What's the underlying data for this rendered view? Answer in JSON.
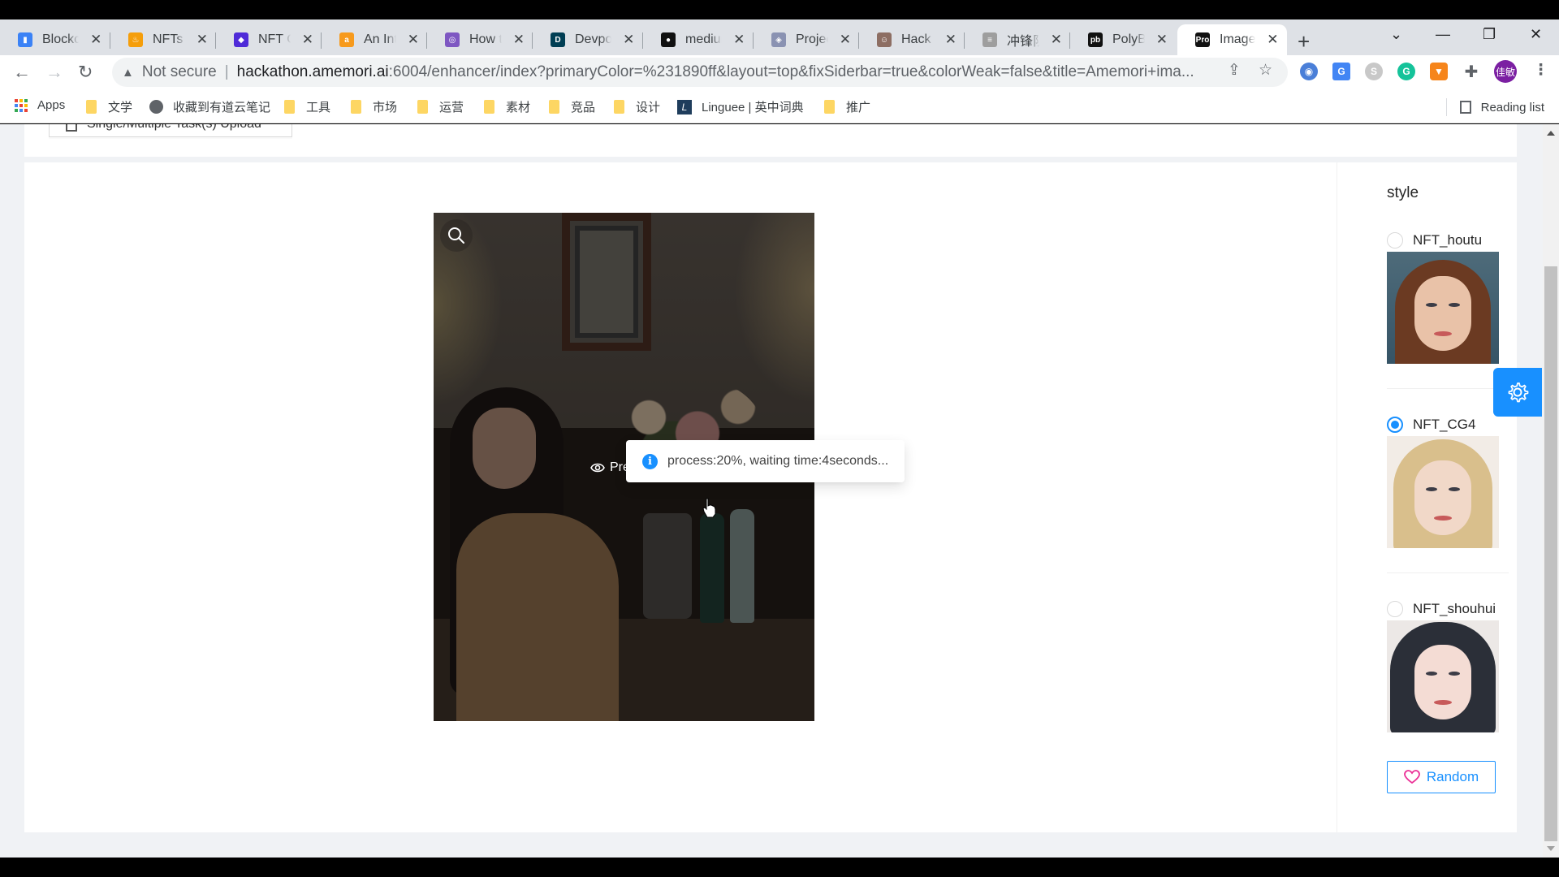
{
  "browser": {
    "tabs": [
      {
        "title": "Blockchain",
        "favicon": "blockchain-icon",
        "color": "#3b82f6",
        "active": false
      },
      {
        "title": "NFTs are",
        "favicon": "flame-icon",
        "color": "#f59e0b",
        "active": false
      },
      {
        "title": "NFT Calendar",
        "favicon": "nft-calendar-icon",
        "color": "#4f2bd8",
        "active": false
      },
      {
        "title": "An Introduction",
        "favicon": "a16z-icon",
        "color": "#f79a1c",
        "active": false
      },
      {
        "title": "How to",
        "favicon": "mirror-icon",
        "color": "#7e57c2",
        "active": false
      },
      {
        "title": "Devpost",
        "favicon": "devpost-icon",
        "color": "#003e54",
        "active": false
      },
      {
        "title": "medium",
        "favicon": "medium-icon",
        "color": "#111111",
        "active": false
      },
      {
        "title": "Project",
        "favicon": "ethereum-icon",
        "color": "#8a92b2",
        "active": false
      },
      {
        "title": "Hack Stack",
        "favicon": "avatar-icon",
        "color": "#8d6e63",
        "active": false
      },
      {
        "title": "冲锋队F",
        "favicon": "sheet-icon",
        "color": "#9e9e9e",
        "active": false
      },
      {
        "title": "PolyBlock",
        "favicon": "pb-icon",
        "color": "#111111",
        "active": false
      },
      {
        "title": "Image",
        "favicon": "pro-icon",
        "color": "#111111",
        "active": true
      }
    ],
    "new_tab_label": "+",
    "address": {
      "security_label": "Not secure",
      "host": "hackathon.amemori.ai",
      "path": ":6004/enhancer/index?primaryColor=%231890ff&layout=top&fixSiderbar=true&colorWeak=false&title=Amemori+ima..."
    },
    "profile_label": "佳敏",
    "bookmarks": [
      {
        "label": "Apps",
        "icon": "apps-grid-icon"
      },
      {
        "label": "文学",
        "icon": "folder-icon"
      },
      {
        "label": "收藏到有道云笔记",
        "icon": "globe-icon"
      },
      {
        "label": "工具",
        "icon": "folder-icon"
      },
      {
        "label": "市场",
        "icon": "folder-icon"
      },
      {
        "label": "运营",
        "icon": "folder-icon"
      },
      {
        "label": "素材",
        "icon": "folder-icon"
      },
      {
        "label": "竞品",
        "icon": "folder-icon"
      },
      {
        "label": "设计",
        "icon": "folder-icon"
      },
      {
        "label": "Linguee | 英中词典",
        "icon": "linguee-icon"
      },
      {
        "label": "推广",
        "icon": "folder-icon"
      }
    ],
    "reading_list_label": "Reading list"
  },
  "page": {
    "upload_button_label": "Single/Multiple Task(s) Upload",
    "preview_label": "Preview",
    "message": {
      "text": "process:20%, waiting time:4seconds...",
      "progress_percent": 20,
      "wait_seconds": 4
    },
    "style_panel": {
      "title": "style",
      "options": [
        {
          "label": "NFT_houtu",
          "selected": false
        },
        {
          "label": "NFT_CG4",
          "selected": true
        },
        {
          "label": "NFT_shouhui",
          "selected": false
        }
      ],
      "random_label": "Random"
    },
    "colors": {
      "primary": "#1890ff",
      "heart": "#eb2f96"
    }
  }
}
